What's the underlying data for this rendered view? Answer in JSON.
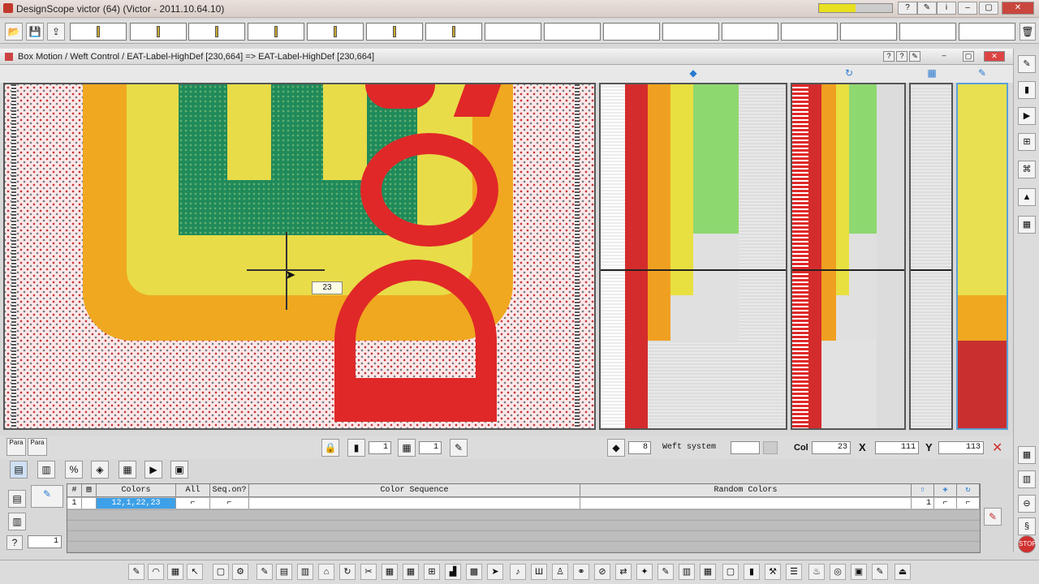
{
  "app": {
    "title": "DesignScope victor (64) (Victor - 2011.10.64.10)"
  },
  "subwindow": {
    "title": "Box Motion / Weft Control  / EAT-Label-HighDef [230,664] => EAT-Label-HighDef [230,664]"
  },
  "canvas": {
    "cursor_tooltip": "23"
  },
  "controls": {
    "para1": "Para",
    "para2": "Para",
    "field_a": "1",
    "field_b": "1",
    "weft_count": "8",
    "weft_label": "Weft system",
    "col_label": "Col",
    "col_value": "23",
    "x_label": "X",
    "x_value": "111",
    "y_label": "Y",
    "y_value": "113",
    "help_field": "1"
  },
  "table": {
    "headers": {
      "num": "#",
      "colors": "Colors",
      "all": "All",
      "seq": "Seq.on?",
      "color_sequence": "Color Sequence",
      "random_colors": "Random Colors"
    },
    "rows": [
      {
        "num": "1",
        "colors": "12,1,22,23",
        "right_num": "1"
      }
    ]
  },
  "palette": {
    "red": "#e02828",
    "orange": "#f0a020",
    "yellow": "#e8e050",
    "green": "#1f8a5a",
    "lightgreen": "#8ed870",
    "pink_bg": "#fbe8ea"
  }
}
